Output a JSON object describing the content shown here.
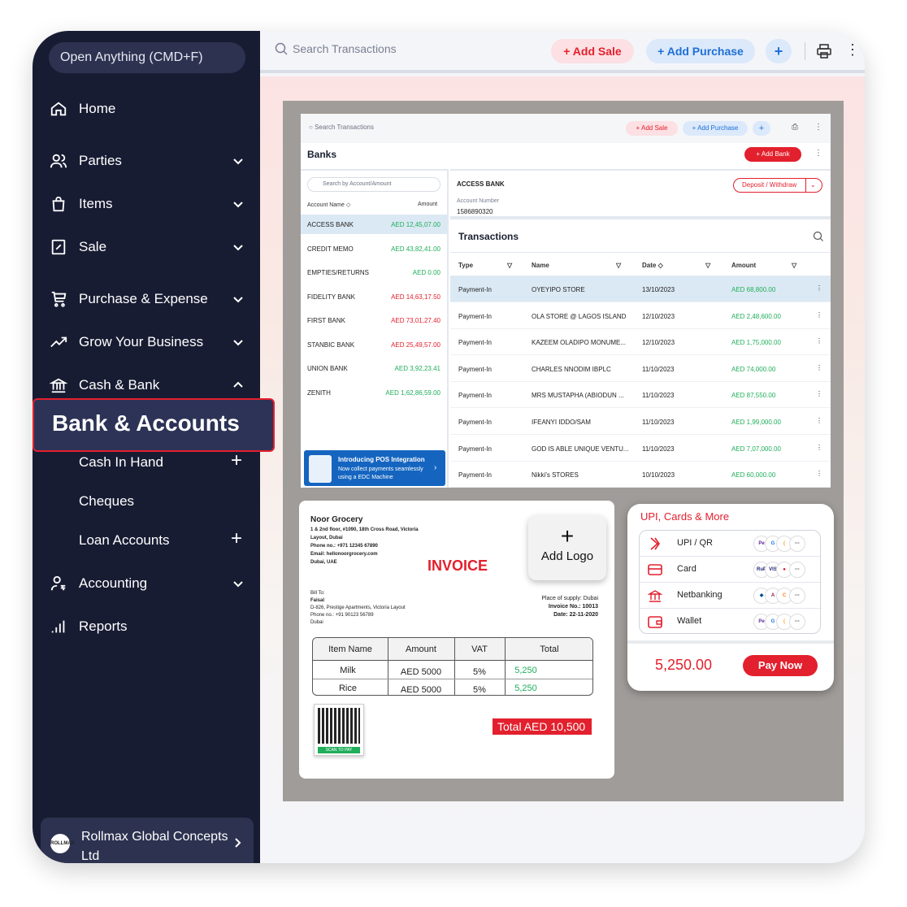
{
  "sidebar": {
    "open_anything": "Open Anything (CMD+F)",
    "items": [
      {
        "label": "Home",
        "icon": "home-icon"
      },
      {
        "label": "Parties",
        "icon": "users-icon"
      },
      {
        "label": "Items",
        "icon": "bag-icon"
      },
      {
        "label": "Sale",
        "icon": "receipt-icon"
      },
      {
        "label": "Purchase & Expense",
        "icon": "cart-icon"
      },
      {
        "label": "Grow Your Business",
        "icon": "trend-up-icon"
      },
      {
        "label": "Cash & Bank",
        "icon": "bank-icon"
      },
      {
        "label": "Accounting",
        "icon": "accounting-icon"
      },
      {
        "label": "Reports",
        "icon": "bar-chart-icon"
      }
    ],
    "active_item": "Bank & Accounts",
    "sub_items": [
      "Cash In Hand",
      "Cheques",
      "Loan Accounts"
    ],
    "company": {
      "name": "Rollmax Global Concepts Ltd",
      "avatar_text": "ROLLMAX"
    }
  },
  "topbar": {
    "search_placeholder": "Search Transactions",
    "add_sale": "+ Add Sale",
    "add_purchase": "+ Add Purchase",
    "plus": "+"
  },
  "inner": {
    "search_placeholder": "Search Transactions",
    "add_sale": "+ Add Sale",
    "add_purchase": "+ Add Purchase",
    "plus": "+",
    "banks_title": "Banks",
    "add_bank": "+ Add Bank",
    "account_search": "Search by Account/Amount",
    "col_account": "Account Name ◇",
    "col_amount": "Amount",
    "accounts": [
      {
        "name": "ACCESS BANK",
        "amount": "AED 12,45,07.00",
        "color": "#1fae5a"
      },
      {
        "name": "CREDIT MEMO",
        "amount": "AED 43,82,41.00",
        "color": "#1fae5a"
      },
      {
        "name": "EMPTIES/RETURNS",
        "amount": "AED 0.00",
        "color": "#1fae5a"
      },
      {
        "name": "FIDELITY BANK",
        "amount": "AED 14,63,17.50",
        "color": "#e3202d"
      },
      {
        "name": "FIRST BANK",
        "amount": "AED 73,01,27.40",
        "color": "#e3202d"
      },
      {
        "name": "STANBIC BANK",
        "amount": "AED 25,49,57.00",
        "color": "#e3202d"
      },
      {
        "name": "UNION BANK",
        "amount": "AED 3,92,23.41",
        "color": "#1fae5a"
      },
      {
        "name": "ZENITH",
        "amount": "AED 1,62,86,59.00",
        "color": "#1fae5a"
      }
    ],
    "pos_title": "Introducing POS Integration",
    "pos_text": "Now collect payments seamlessly using a EDC Machine",
    "selected_bank": "ACCESS BANK",
    "account_number_label": "Account Number",
    "account_number": "1586890320",
    "deposit_withdraw": "Deposit / Withdraw",
    "transactions_title": "Transactions",
    "tx_headers": {
      "type": "Type",
      "name": "Name",
      "date": "Date ◇",
      "amount": "Amount"
    },
    "transactions": [
      {
        "type": "Payment-In",
        "name": "OYEYIPO STORE",
        "date": "13/10/2023",
        "amount": "AED 68,800.00"
      },
      {
        "type": "Payment-In",
        "name": "OLA STORE @ LAGOS ISLAND",
        "date": "12/10/2023",
        "amount": "AED 2,48,600.00"
      },
      {
        "type": "Payment-In",
        "name": "KAZEEM OLADIPO MONUME...",
        "date": "12/10/2023",
        "amount": "AED 1,75,000.00"
      },
      {
        "type": "Payment-In",
        "name": "CHARLES NNODIM IBPLC",
        "date": "11/10/2023",
        "amount": "AED 74,000.00"
      },
      {
        "type": "Payment-In",
        "name": "MRS MUSTAPHA (ABIODUN ...",
        "date": "11/10/2023",
        "amount": "AED 87,550.00"
      },
      {
        "type": "Payment-In",
        "name": "IFEANYI IDDO/SAM",
        "date": "11/10/2023",
        "amount": "AED 1,99,000.00"
      },
      {
        "type": "Payment-In",
        "name": "GOD IS ABLE UNIQUE VENTU...",
        "date": "11/10/2023",
        "amount": "AED 7,07,000.00"
      },
      {
        "type": "Payment-In",
        "name": "Nikki's STORES",
        "date": "10/10/2023",
        "amount": "AED 60,000.00"
      }
    ]
  },
  "invoice": {
    "shop": "Noor Grocery",
    "address": "1 & 2nd floor, #1090, 18th Cross Road, Victoria Layout, Dubai",
    "phone": "Phone no.: +971 12345 67890",
    "email": "Email: hellonoorgrocery.com",
    "city": "Dubai, UAE",
    "title": "INVOICE",
    "add_logo": "Add Logo",
    "bill_to_label": "Bill To:",
    "bill_to_name": "Faisal",
    "bill_to_address": "D-826, Prestige Apartments, Victoria Layout",
    "bill_to_phone": "Phone no.: +91 90123 56789",
    "bill_to_city": "Dubai",
    "place_of_supply": "Place of supply: Dubai",
    "invoice_no": "Invoice No.: 10013",
    "date": "Date: 22-11-2020",
    "headers": [
      "Item Name",
      "Amount",
      "VAT",
      "Total"
    ],
    "rows": [
      {
        "item": "Milk",
        "amount": "AED 5000",
        "vat": "5%",
        "total": "5,250"
      },
      {
        "item": "Rice",
        "amount": "AED 5000",
        "vat": "5%",
        "total": "5,250"
      }
    ],
    "qr_label": "SCAN TO PAY",
    "total": "Total  AED 10,500"
  },
  "payment": {
    "title": "UPI, Cards & More",
    "options": [
      "UPI / QR",
      "Card",
      "Netbanking",
      "Wallet"
    ],
    "amount": "5,250.00",
    "pay_now": "Pay Now"
  },
  "colors": {
    "sidebar": "#181c33",
    "accent_red": "#e3202d",
    "accent_blue": "#1f6fd6",
    "positive": "#1fae5a"
  }
}
